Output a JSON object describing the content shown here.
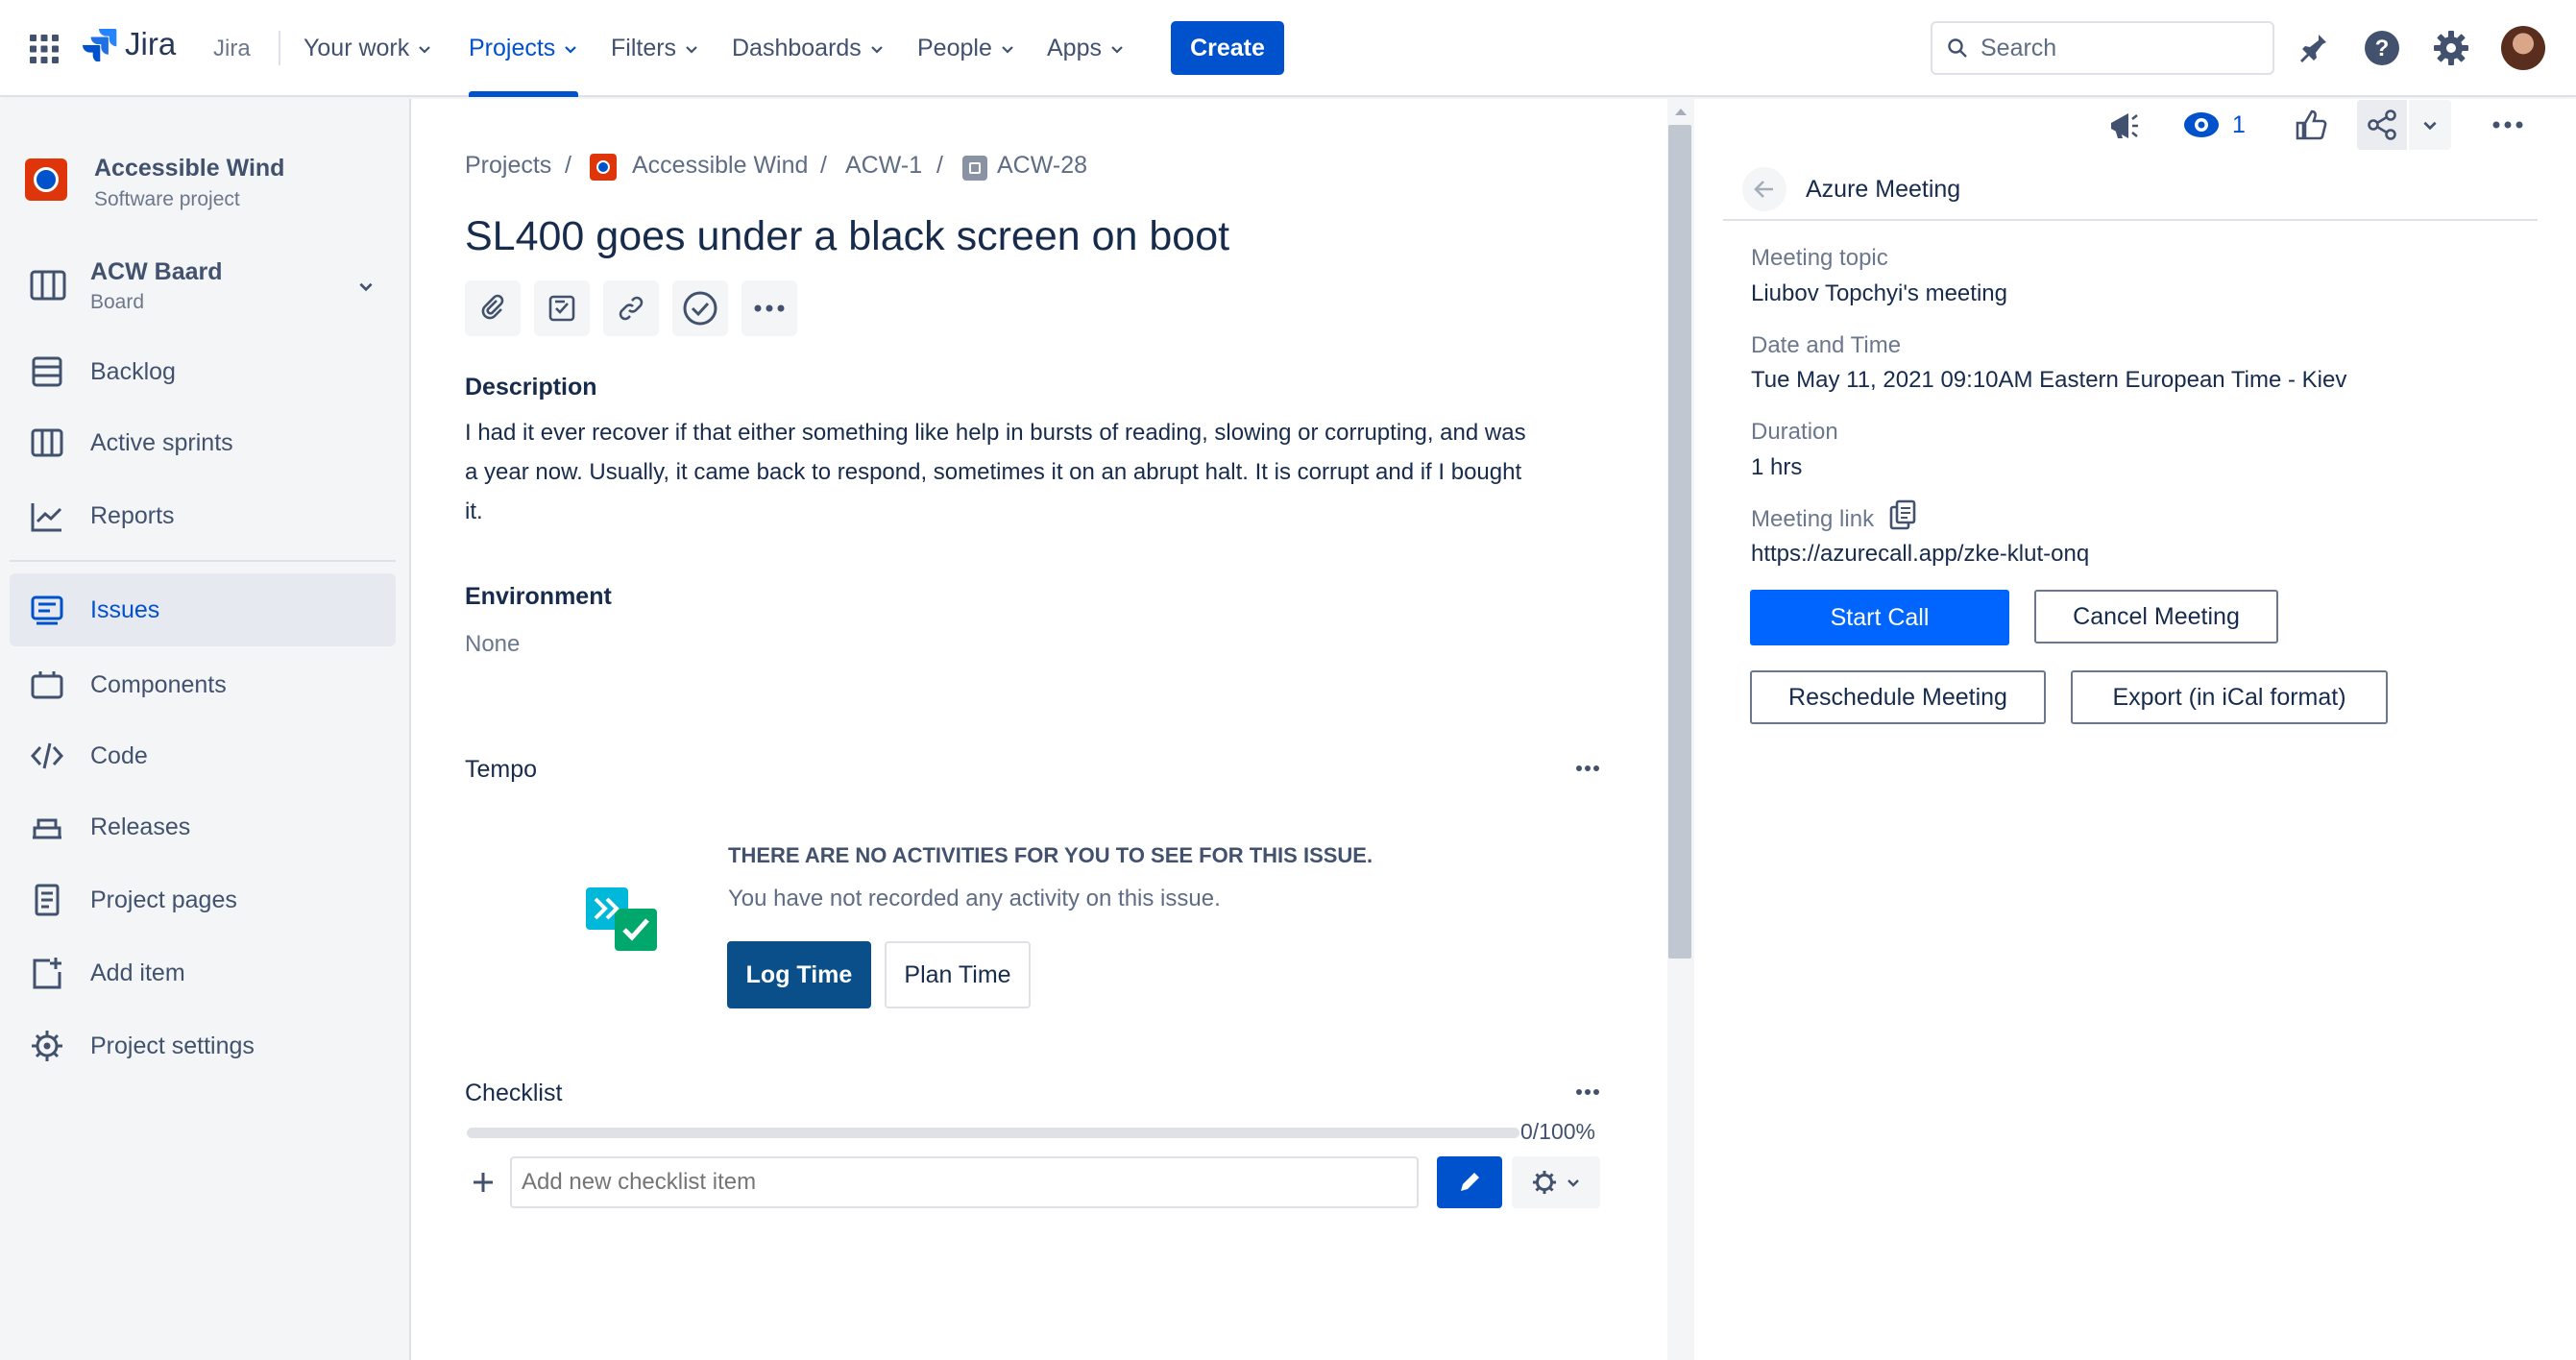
{
  "topnav": {
    "app_switcher_icon": "grid-icon",
    "logo_text": "Jira",
    "product_label": "Jira",
    "links": {
      "your_work": "Your work",
      "projects": "Projects",
      "filters": "Filters",
      "dashboards": "Dashboards",
      "people": "People",
      "apps": "Apps"
    },
    "create_label": "Create",
    "search_placeholder": "Search",
    "icons": [
      "notification-icon",
      "help-icon",
      "settings-icon",
      "avatar"
    ]
  },
  "sidebar": {
    "project_name": "Accessible Wind",
    "project_type": "Software project",
    "board_name": "ACW Baard",
    "board_type": "Board",
    "items": {
      "backlog": "Backlog",
      "active_sprints": "Active sprints",
      "reports": "Reports",
      "issues": "Issues",
      "components": "Components",
      "code": "Code",
      "releases": "Releases",
      "project_pages": "Project pages",
      "add_item": "Add item",
      "project_settings": "Project settings"
    }
  },
  "issue": {
    "breadcrumb": {
      "projects": "Projects",
      "project": "Accessible Wind",
      "epic": "ACW-1",
      "key": "ACW-28",
      "separator": "/"
    },
    "title": "SL400 goes under a black screen on boot",
    "description_label": "Description",
    "description_lines": [
      "I had it ever recover if that either something like help in bursts of reading, slowing or corrupting, and was",
      "a year now. Usually, it came back to respond, sometimes it on an abrupt halt. It is corrupt and if I bought",
      "it."
    ],
    "environment_label": "Environment",
    "environment_value": "None"
  },
  "tempo": {
    "title": "Tempo",
    "empty_title": "THERE ARE NO ACTIVITIES FOR YOU TO SEE FOR THIS ISSUE.",
    "empty_text": "You have not recorded any activity on this issue.",
    "log_time": "Log Time",
    "plan_time": "Plan Time"
  },
  "checklist": {
    "title": "Checklist",
    "progress_label": "0/100%",
    "progress_fraction": 0,
    "input_placeholder": "Add new checklist item"
  },
  "rightpanel": {
    "watch_count": "1",
    "header_title": "Azure Meeting",
    "meeting_topic_label": "Meeting topic",
    "meeting_topic": "Liubov Topchyi's meeting",
    "date_label": "Date and Time",
    "date_value": "Tue May 11, 2021 09:10AM Eastern European Time - Kiev",
    "duration_label": "Duration",
    "duration_value": "1 hrs",
    "link_label": "Meeting link",
    "link_value": "https://azurecall.app/zke-klut-onq",
    "start_call": "Start Call",
    "cancel_meeting": "Cancel Meeting",
    "reschedule": "Reschedule Meeting",
    "export": "Export (in iCal format)"
  },
  "colors": {
    "brand": "#0052cc",
    "tempo_button": "#0b4f8a",
    "sidebar_bg": "#f4f5f7",
    "text": "#172b4d"
  }
}
